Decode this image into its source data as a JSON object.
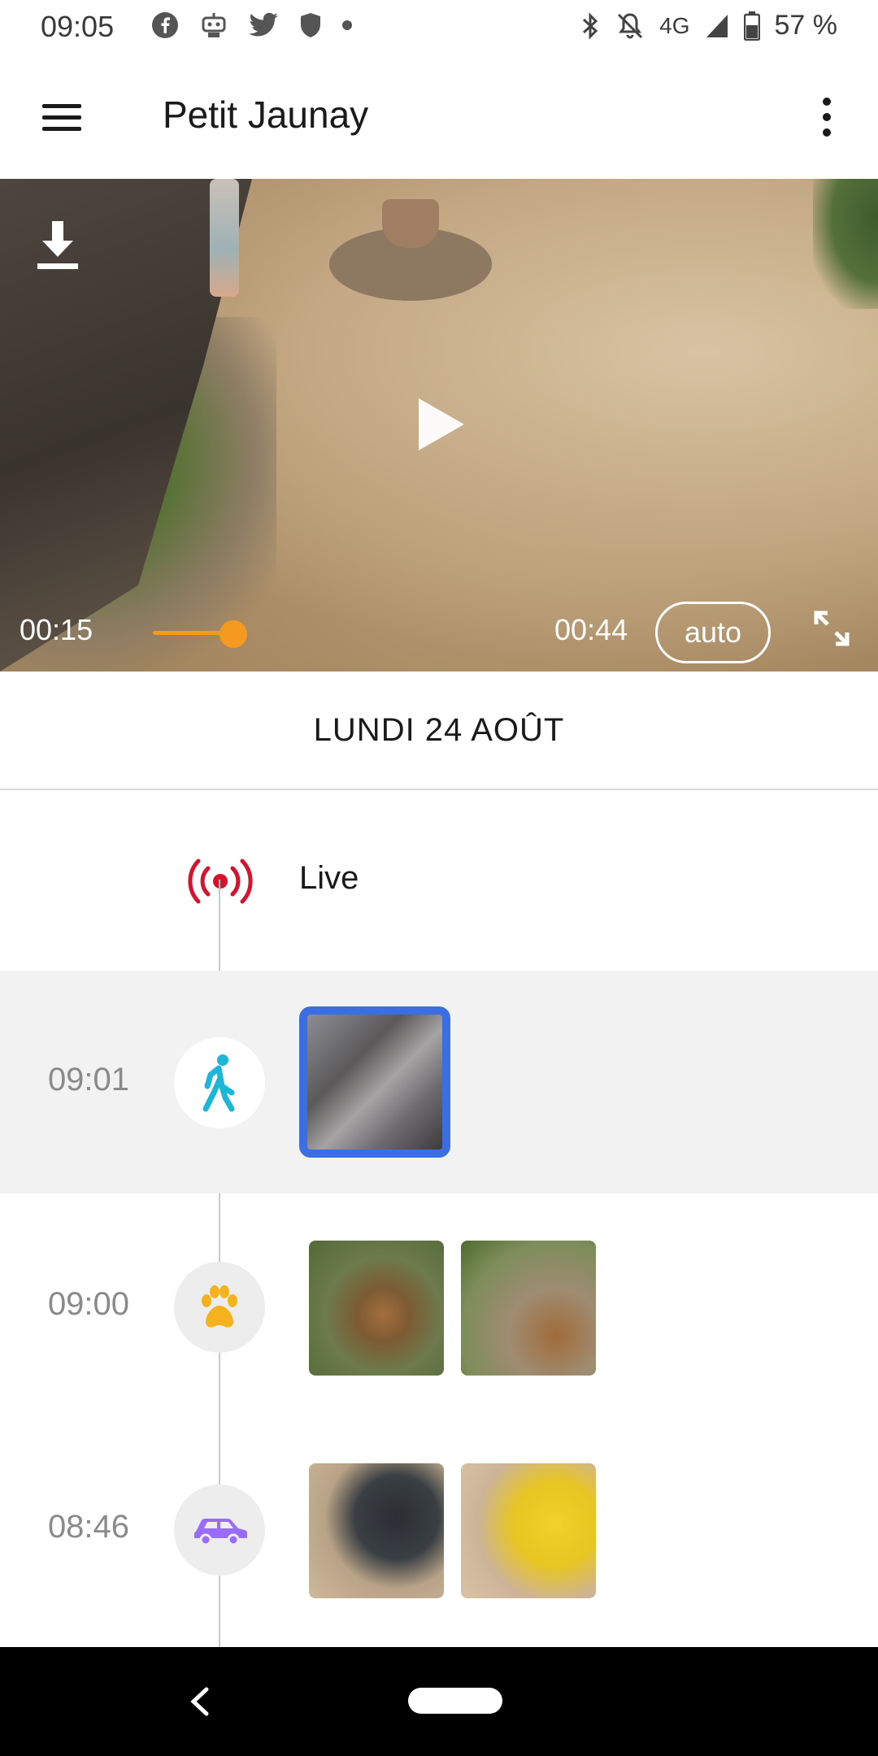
{
  "status_bar": {
    "time": "09:05",
    "left_icons": [
      "facebook-icon",
      "robot-icon",
      "twitter-icon",
      "shield-icon",
      "dot-icon"
    ],
    "network": "4G",
    "battery": "57 %"
  },
  "app_bar": {
    "title": "Petit Jaunay"
  },
  "player": {
    "current_time": "00:15",
    "duration": "00:44",
    "progress": 0.34,
    "quality_label": "auto",
    "accent_color": "#f59a20"
  },
  "date_header": "LUNDI 24 AOÛT",
  "timeline": {
    "live_label": "Live",
    "live_color": "#d6122c",
    "events": [
      {
        "time": "09:01",
        "type": "person",
        "icon": "walking-person-icon",
        "icon_color": "#1bb6d8",
        "thumbnails": [
          "person-thumbnail"
        ],
        "selected": true
      },
      {
        "time": "09:00",
        "type": "animal",
        "icon": "paw-icon",
        "icon_color": "#f6b21c",
        "thumbnails": [
          "deer-thumbnail-1",
          "deer-thumbnail-2"
        ]
      },
      {
        "time": "08:46",
        "type": "vehicle",
        "icon": "car-icon",
        "icon_color": "#9a6bff",
        "thumbnails": [
          "car-thumbnail-black",
          "car-thumbnail-yellow"
        ]
      }
    ],
    "selection_color": "#3b6ee0"
  }
}
